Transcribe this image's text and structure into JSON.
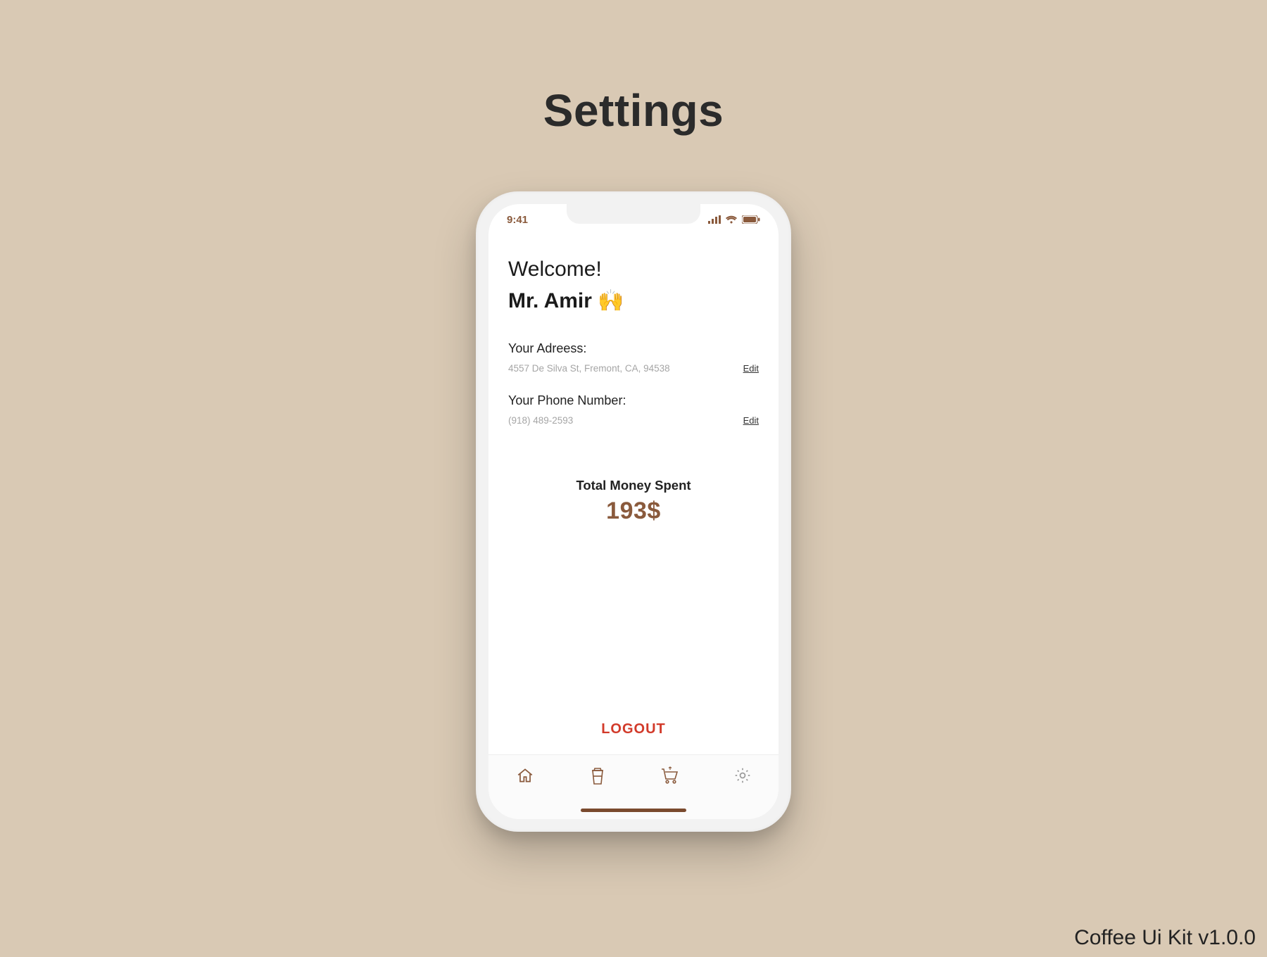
{
  "page": {
    "title": "Settings",
    "kit_version": "Coffee Ui Kit v1.0.0"
  },
  "colors": {
    "accent": "#8a5a3c",
    "danger": "#d23a2a",
    "bg": "#d9c9b4"
  },
  "status_bar": {
    "time": "9:41",
    "icons": [
      "cellular-icon",
      "wifi-icon",
      "battery-icon"
    ]
  },
  "profile": {
    "welcome": "Welcome!",
    "name": "Mr. Amir 🙌",
    "address": {
      "label": "Your Adreess:",
      "value": "4557 De Silva St, Fremont, CA, 94538",
      "edit_label": "Edit"
    },
    "phone": {
      "label": "Your Phone Number:",
      "value": "(918) 489-2593",
      "edit_label": "Edit"
    },
    "spent": {
      "label": "Total Money Spent",
      "value": "193$"
    },
    "logout_label": "LOGOUT"
  },
  "nav": {
    "items": [
      {
        "name": "home-icon"
      },
      {
        "name": "cup-icon"
      },
      {
        "name": "cart-icon"
      },
      {
        "name": "gear-icon"
      }
    ]
  }
}
